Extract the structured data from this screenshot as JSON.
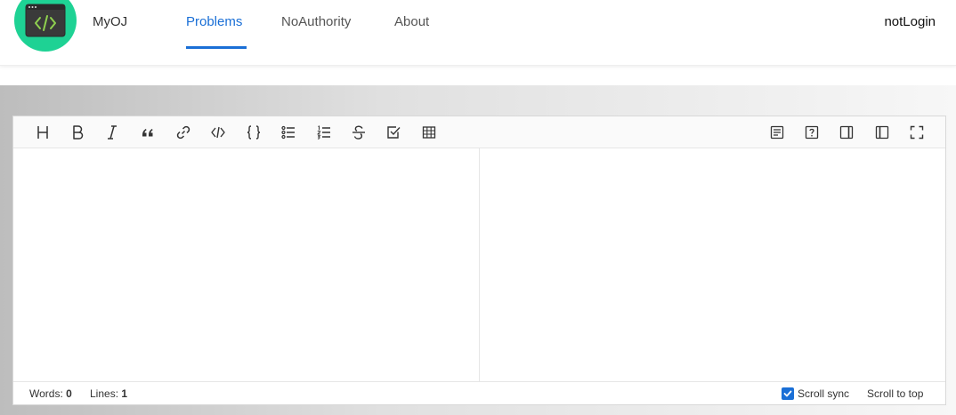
{
  "header": {
    "brand": "MyOJ",
    "nav": [
      {
        "label": "Problems",
        "active": true
      },
      {
        "label": "NoAuthority",
        "active": false
      },
      {
        "label": "About",
        "active": false
      }
    ],
    "user": "notLogin",
    "logo_icon": "code-window-icon"
  },
  "editor": {
    "toolbar_left": [
      {
        "icon": "heading-icon",
        "glyph": "H"
      },
      {
        "icon": "bold-icon",
        "glyph": "B"
      },
      {
        "icon": "italic-icon",
        "glyph": "I"
      },
      {
        "icon": "quote-icon"
      },
      {
        "icon": "link-icon"
      },
      {
        "icon": "code-icon"
      },
      {
        "icon": "code-block-icon",
        "glyph": "{ }"
      },
      {
        "icon": "unordered-list-icon"
      },
      {
        "icon": "ordered-list-icon"
      },
      {
        "icon": "strikethrough-icon",
        "glyph": "S"
      },
      {
        "icon": "task-list-icon"
      },
      {
        "icon": "table-icon"
      }
    ],
    "toolbar_right": [
      {
        "icon": "toc-icon"
      },
      {
        "icon": "help-icon"
      },
      {
        "icon": "preview-only-icon"
      },
      {
        "icon": "split-view-icon"
      },
      {
        "icon": "fullscreen-icon"
      }
    ],
    "status": {
      "words_label": "Words:",
      "words": "0",
      "lines_label": "Lines:",
      "lines": "1",
      "scroll_sync": "Scroll sync",
      "scroll_sync_checked": true,
      "scroll_top": "Scroll to top"
    }
  },
  "colors": {
    "accent": "#1a6fd6",
    "logo_bg": "#1ed294"
  }
}
